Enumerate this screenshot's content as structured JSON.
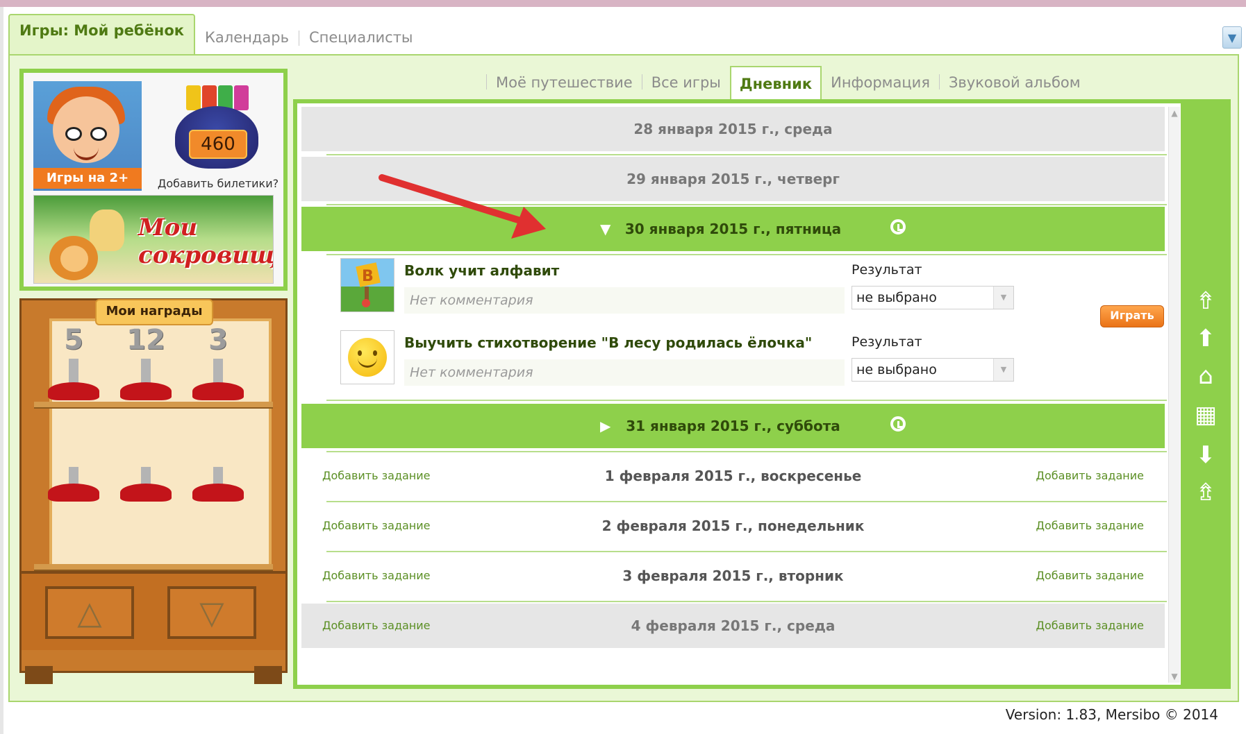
{
  "top_tabs": {
    "games_my_child": "Игры: Мой ребёнок",
    "calendar": "Календарь",
    "specialists": "Специалисты"
  },
  "sidebar": {
    "games_label": "Игры на 2+",
    "tickets_count": "460",
    "add_tickets": "Добавить билетики?",
    "treasures_line1": "Мои",
    "treasures_line2": "сокровища",
    "awards_title": "Мои награды",
    "awards": [
      "5",
      "12",
      "3",
      "",
      "",
      ""
    ]
  },
  "sub_tabs": {
    "journey": "Моё путешествие",
    "all_games": "Все игры",
    "diary": "Дневник",
    "info": "Информация",
    "sound_album": "Звуковой альбом"
  },
  "diary": {
    "add_task": "Добавить задание",
    "days": [
      {
        "date": "28 января 2015 г., среда"
      },
      {
        "date": "29 января 2015 г., четверг"
      },
      {
        "date": "30 января 2015 г., пятница"
      },
      {
        "date": "31 января 2015 г., суббота"
      },
      {
        "date": "1 февраля 2015 г., воскресенье"
      },
      {
        "date": "2 февраля 2015 г., понедельник"
      },
      {
        "date": "3 февраля 2015 г., вторник"
      },
      {
        "date": "4 февраля 2015 г., среда"
      }
    ],
    "tasks": [
      {
        "title": "Волк учит алфавит",
        "comment": "Нет комментария",
        "result_label": "Результат",
        "result_value": "не выбрано"
      },
      {
        "title": "Выучить стихотворение \"В лесу родилась ёлочка\"",
        "comment": "Нет комментария",
        "result_label": "Результат",
        "result_value": "не выбрано"
      }
    ],
    "play_button": "Играть"
  },
  "footer": {
    "version": "Version: 1.83, Mersibo © 2014"
  },
  "colors": {
    "accent_green": "#8ed04b",
    "tab_green_text": "#4f7a13",
    "play_orange": "#ea7317",
    "annotation_red": "#e03030"
  }
}
